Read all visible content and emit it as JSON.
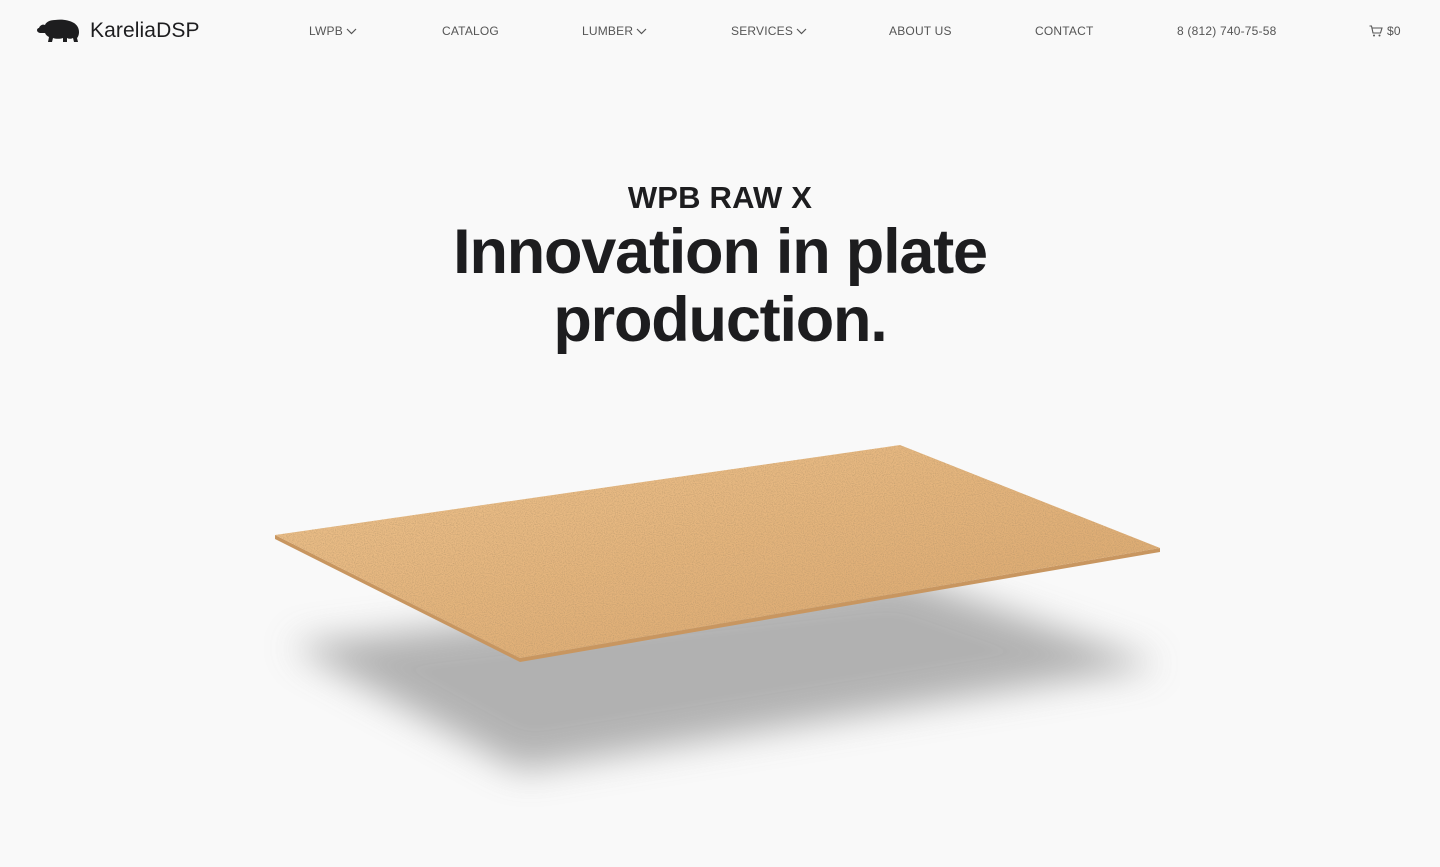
{
  "brand": {
    "name": "KareliaDSP",
    "logo_icon": "bear-icon"
  },
  "nav": {
    "items": [
      {
        "label": "LWPB",
        "has_dropdown": true
      },
      {
        "label": "CATALOG",
        "has_dropdown": false
      },
      {
        "label": "LUMBER",
        "has_dropdown": true
      },
      {
        "label": "SERVICES",
        "has_dropdown": true
      },
      {
        "label": "ABOUT US",
        "has_dropdown": false
      },
      {
        "label": "CONTACT",
        "has_dropdown": false
      }
    ],
    "phone": "8 (812) 740-75-58",
    "cart": {
      "icon": "cart-icon",
      "total": "$0"
    }
  },
  "hero": {
    "subtitle": "WPB RAW X",
    "title_line1": "Innovation in plate",
    "title_line2": "production.",
    "image_icon": "particle-board-image"
  },
  "colors": {
    "background": "#f9f9f9",
    "text": "#1d1d1f",
    "nav_text": "#555555",
    "board": "#e2b27c"
  }
}
